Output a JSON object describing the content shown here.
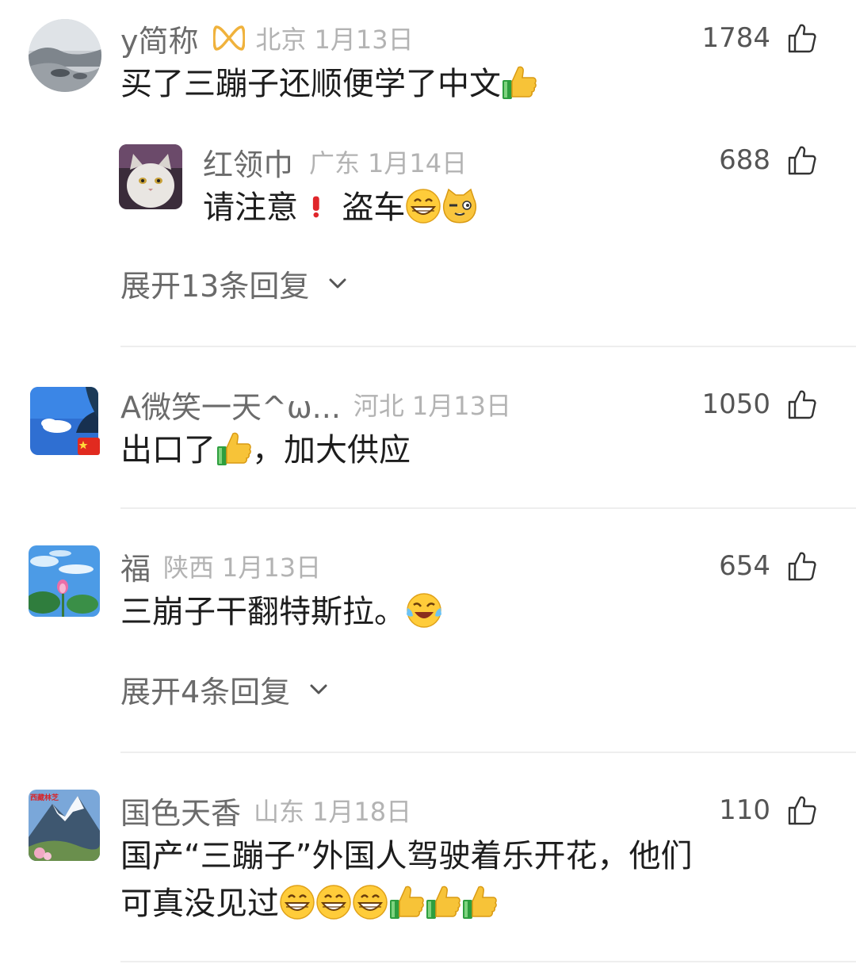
{
  "comments": [
    {
      "name": "y简称",
      "region": "北京",
      "date": "1月13日",
      "likes": "1784",
      "text_parts": [
        "买了三蹦子还顺便学了中文"
      ],
      "reply": {
        "name": "红领巾",
        "region": "广东",
        "date": "1月14日",
        "likes": "688",
        "text_a": "请注意",
        "text_b": "盗车"
      },
      "expand_label": "展开13条回复"
    },
    {
      "name": "A微笑一天^ω...",
      "region": "河北",
      "date": "1月13日",
      "likes": "1050",
      "text_a": "出口了",
      "text_b": "，加大供应"
    },
    {
      "name": "福",
      "region": "陕西",
      "date": "1月13日",
      "likes": "654",
      "text": "三崩子干翻特斯拉。",
      "expand_label": "展开4条回复"
    },
    {
      "name": "国色天香",
      "region": "山东",
      "date": "1月18日",
      "likes": "110",
      "line1": "国产“三蹦子”外国人驾驶着乐开花，他们",
      "line2": "可真没见过"
    }
  ],
  "avatar_4_caption": "西藏林芝",
  "icons": [
    "thumbs-up-outline-icon",
    "chevron-down-icon",
    "thumbs-up-emoji",
    "grin-emoji",
    "cat-emoji",
    "red-exclamation-icon",
    "laugh-tears-emoji",
    "china-flag-badge",
    "vip-badge"
  ]
}
